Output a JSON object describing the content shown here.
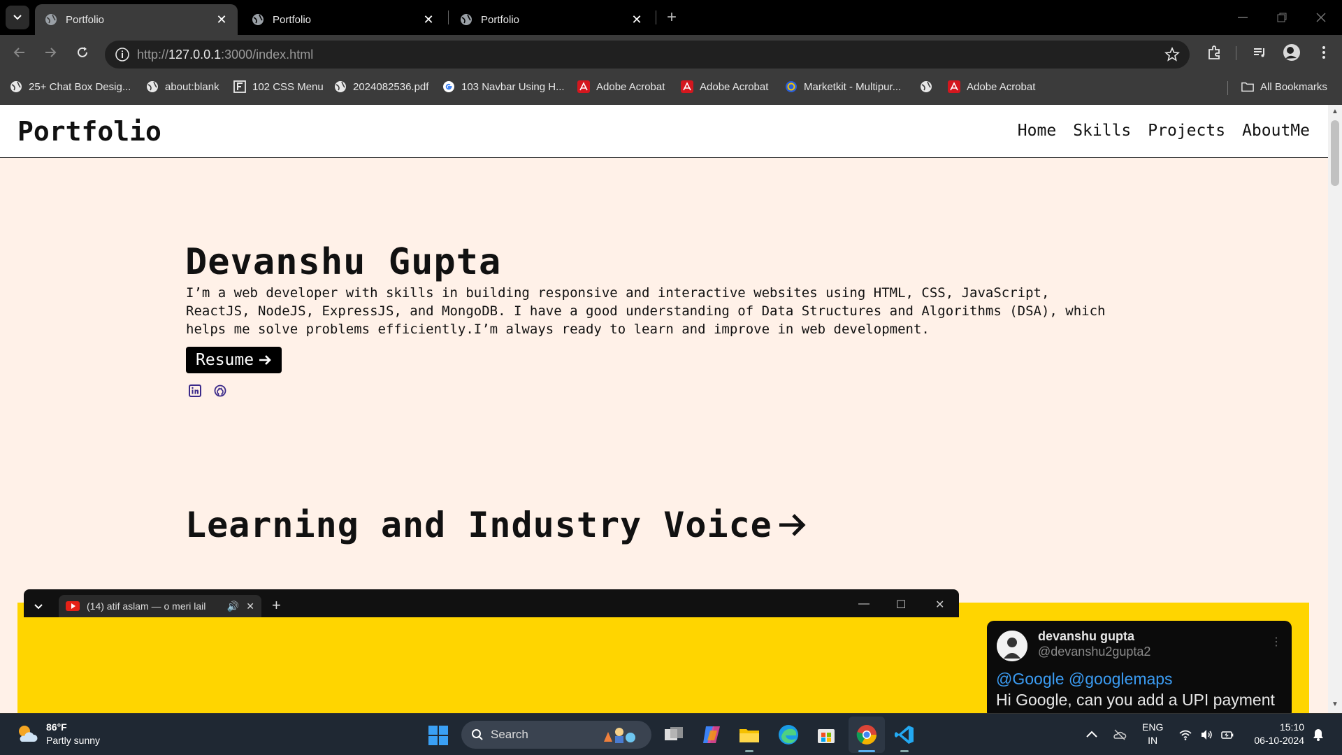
{
  "browser": {
    "tabs": [
      {
        "title": "Portfolio",
        "active": true
      },
      {
        "title": "Portfolio",
        "active": false
      },
      {
        "title": "Portfolio",
        "active": false
      }
    ],
    "url": {
      "scheme": "http://",
      "host": "127.0.0.1",
      "rest": ":3000/index.html"
    },
    "bookmarks": [
      {
        "label": "25+ Chat Box Desig...",
        "icon": "globe-icon"
      },
      {
        "label": "about:blank",
        "icon": "globe-icon"
      },
      {
        "label": "102 CSS Menu",
        "icon": "f-icon"
      },
      {
        "label": "2024082536.pdf",
        "icon": "globe-icon"
      },
      {
        "label": "103 Navbar Using H...",
        "icon": "google-icon"
      },
      {
        "label": "Adobe Acrobat",
        "icon": "acrobat-icon"
      },
      {
        "label": "Adobe Acrobat",
        "icon": "acrobat-icon"
      },
      {
        "label": "Marketkit - Multipur...",
        "icon": "marketkit-icon"
      },
      {
        "label": "",
        "icon": "globe-icon"
      },
      {
        "label": "Adobe Acrobat",
        "icon": "acrobat-icon"
      }
    ],
    "all_bookmarks": "All Bookmarks"
  },
  "page": {
    "brand": "Portfolio",
    "nav": [
      "Home",
      "Skills",
      "Projects",
      "AboutMe"
    ],
    "hero": {
      "name": "Devanshu Gupta",
      "description": "I’m a web developer with skills in building responsive and interactive websites using HTML, CSS, JavaScript, ReactJS, NodeJS, ExpressJS, and MongoDB. I have a good understanding of Data Structures and Algorithms (DSA), which helps me solve problems efficiently.I’m always ready to learn and improve in web development.",
      "resume_label": "Resume"
    },
    "section_title": "Learning and Industry Voice",
    "tweet": {
      "name": "devanshu gupta",
      "handle": "@devanshu2gupta2",
      "mentions": "@Google @googlemaps",
      "text": "Hi Google, can you add a UPI payment"
    },
    "mini_window": {
      "tab_title": "(14) atif aslam — o meri lail"
    }
  },
  "taskbar": {
    "weather": {
      "temp": "86°F",
      "condition": "Partly sunny"
    },
    "search": "Search",
    "lang": [
      "ENG",
      "IN"
    ],
    "time": "15:10",
    "date": "06-10-2024"
  },
  "colors": {
    "page_bg": "#fff1e8",
    "yellow": "#ffd500",
    "link_blue": "#3b9cf3",
    "social_icon": "#3b2a8a"
  }
}
